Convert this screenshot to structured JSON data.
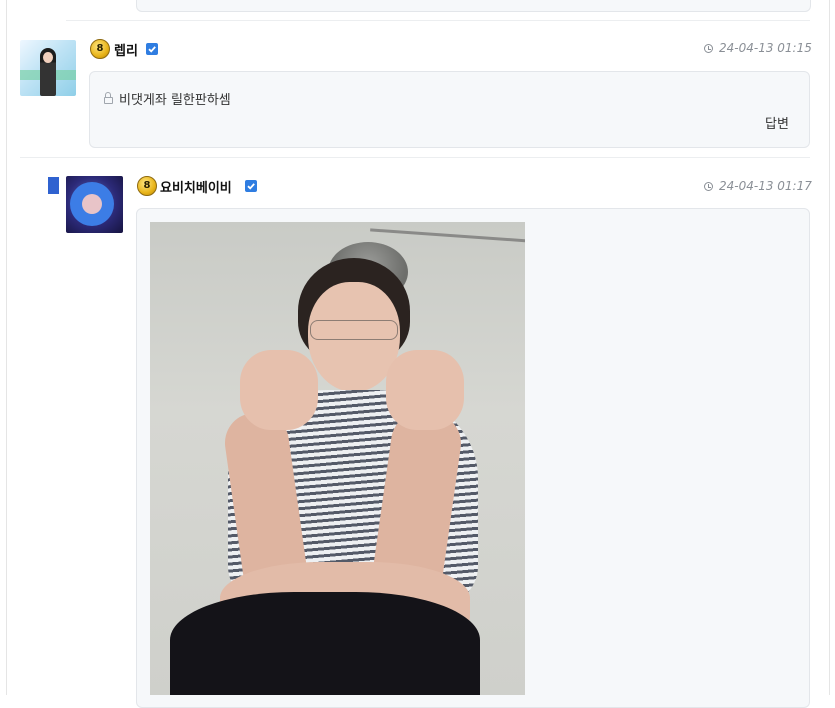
{
  "comments": [
    {
      "author": "렙리",
      "level": "8",
      "timestamp": "24-04-13 01:15",
      "locked": true,
      "text": "비댓게좌 릴한판하셈",
      "reply_label": "답변"
    },
    {
      "author": "요비치베이비",
      "level": "8",
      "timestamp": "24-04-13 01:17",
      "is_reply": true,
      "attachment": "image"
    }
  ],
  "colors": {
    "verify_badge": "#2f7de1",
    "reply_marker": "#2f62d0",
    "box_bg": "#f6f8fa",
    "timestamp": "#8a8f96"
  },
  "icons": [
    "level-badge-icon",
    "verified-icon",
    "clock-icon",
    "lock-icon"
  ]
}
